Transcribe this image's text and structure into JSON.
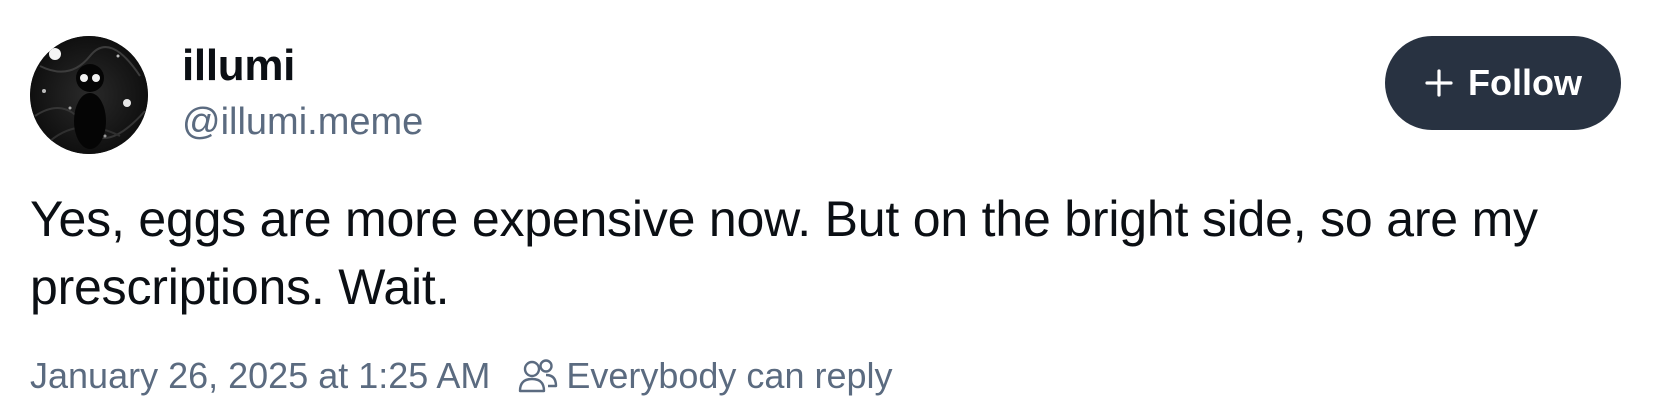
{
  "author": {
    "display_name": "illumi",
    "handle": "@illumi.meme",
    "avatar_icon": "avatar-image"
  },
  "follow_button": {
    "label": "Follow",
    "icon": "plus-icon",
    "background": "#283241",
    "text_color": "#ffffff"
  },
  "post": {
    "text": "Yes, eggs are more expensive now. But on the bright side, so are my prescriptions. Wait.",
    "timestamp": "January 26, 2025 at 1:25 AM",
    "reply_setting": "Everybody can reply",
    "reply_setting_icon": "people-icon"
  },
  "colors": {
    "text_primary": "#0b0f14",
    "text_secondary": "#5b6b80"
  }
}
